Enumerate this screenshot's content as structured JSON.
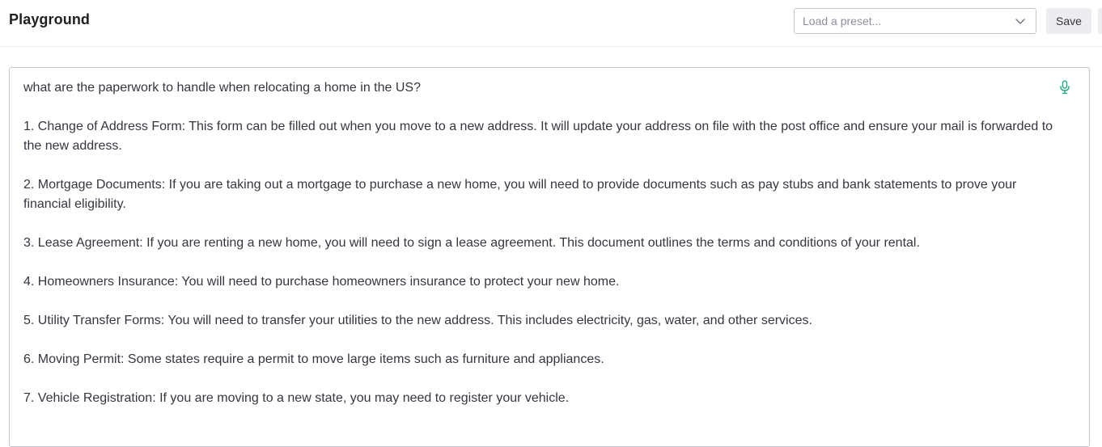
{
  "header": {
    "title": "Playground",
    "preset_placeholder": "Load a preset...",
    "save_label": "Save"
  },
  "editor": {
    "paragraphs": [
      "what are the paperwork to handle when relocating a home in the US?",
      "1. Change of Address Form: This form can be filled out when you move to a new address. It will update your address on file with the post office and ensure your mail is forwarded to the new address.",
      "2. Mortgage Documents: If you are taking out a mortgage to purchase a new home, you will need to provide documents such as pay stubs and bank statements to prove your financial eligibility.",
      "3. Lease Agreement: If you are renting a new home, you will need to sign a lease agreement. This document outlines the terms and conditions of your rental.",
      "4. Homeowners Insurance: You will need to purchase homeowners insurance to protect your new home.",
      "5. Utility Transfer Forms: You will need to transfer your utilities to the new address. This includes electricity, gas, water, and other services.",
      "6. Moving Permit: Some states require a permit to move large items such as furniture and appliances.",
      "7. Vehicle Registration: If you are moving to a new state, you may need to register your vehicle."
    ]
  },
  "icons": {
    "mic": "microphone-icon",
    "chevron": "chevron-down-icon"
  },
  "colors": {
    "accent": "#10a37f",
    "border": "#c5c5d2",
    "button_bg": "#ececf1",
    "text": "#353740"
  }
}
